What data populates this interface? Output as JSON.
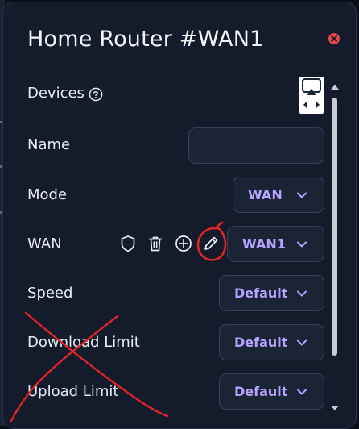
{
  "dialog": {
    "title": "Home Router #WAN1"
  },
  "rows": {
    "devices": {
      "label": "Devices"
    },
    "name": {
      "label": "Name",
      "value": "",
      "placeholder": ""
    },
    "mode": {
      "label": "Mode",
      "value": "WAN"
    },
    "wan": {
      "label": "WAN",
      "value": "WAN1"
    },
    "speed": {
      "label": "Speed",
      "value": "Default"
    },
    "download_limit": {
      "label": "Download Limit",
      "value": "Default"
    },
    "upload_limit": {
      "label": "Upload Limit",
      "value": "Default"
    }
  },
  "icons": {
    "close": "close-icon",
    "help": "help-circle-icon",
    "devices": "cast-screen-icon",
    "shield": "shield-icon",
    "delete": "trash-icon",
    "add": "plus-circle-icon",
    "edit": "pencil-icon"
  },
  "colors": {
    "panel_bg": "#141b2a",
    "accent_text": "#b6a2ff",
    "close": "#e5484d",
    "annotation": "#e0242b"
  }
}
